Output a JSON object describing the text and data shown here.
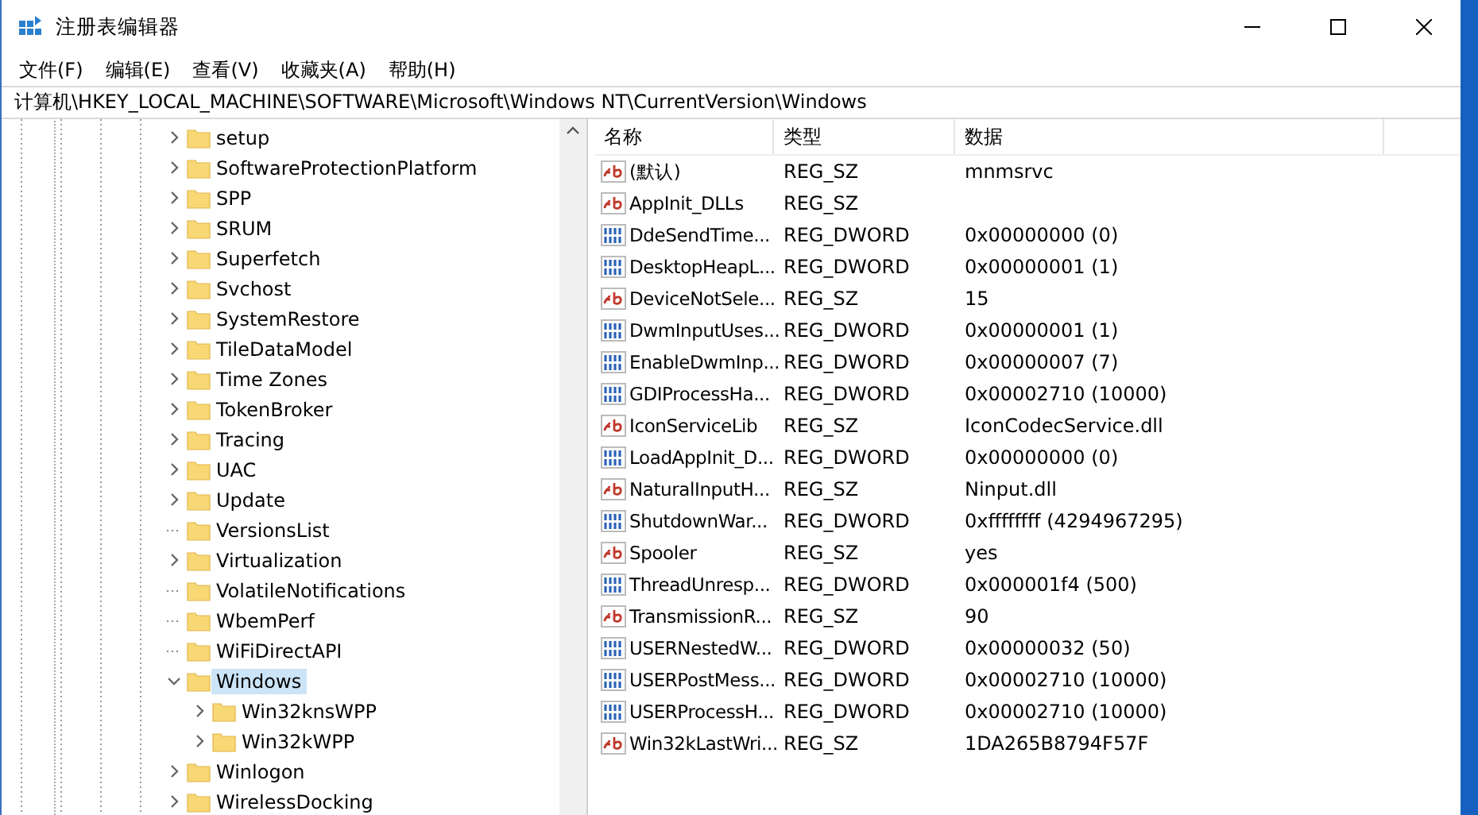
{
  "window": {
    "title": "注册表编辑器"
  },
  "menu": [
    {
      "label": "文件(F)"
    },
    {
      "label": "编辑(E)"
    },
    {
      "label": "查看(V)"
    },
    {
      "label": "收藏夹(A)"
    },
    {
      "label": "帮助(H)"
    }
  ],
  "address": "计算机\\HKEY_LOCAL_MACHINE\\SOFTWARE\\Microsoft\\Windows NT\\CurrentVersion\\Windows",
  "tree": [
    {
      "label": "setup",
      "expandable": true,
      "expanded": false,
      "selected": false
    },
    {
      "label": "SoftwareProtectionPlatform",
      "expandable": true,
      "expanded": false,
      "selected": false
    },
    {
      "label": "SPP",
      "expandable": true,
      "expanded": false,
      "selected": false
    },
    {
      "label": "SRUM",
      "expandable": true,
      "expanded": false,
      "selected": false
    },
    {
      "label": "Superfetch",
      "expandable": true,
      "expanded": false,
      "selected": false
    },
    {
      "label": "Svchost",
      "expandable": true,
      "expanded": false,
      "selected": false
    },
    {
      "label": "SystemRestore",
      "expandable": true,
      "expanded": false,
      "selected": false
    },
    {
      "label": "TileDataModel",
      "expandable": true,
      "expanded": false,
      "selected": false
    },
    {
      "label": "Time Zones",
      "expandable": true,
      "expanded": false,
      "selected": false
    },
    {
      "label": "TokenBroker",
      "expandable": true,
      "expanded": false,
      "selected": false
    },
    {
      "label": "Tracing",
      "expandable": true,
      "expanded": false,
      "selected": false
    },
    {
      "label": "UAC",
      "expandable": true,
      "expanded": false,
      "selected": false
    },
    {
      "label": "Update",
      "expandable": true,
      "expanded": false,
      "selected": false
    },
    {
      "label": "VersionsList",
      "expandable": false,
      "selected": false
    },
    {
      "label": "Virtualization",
      "expandable": true,
      "expanded": false,
      "selected": false
    },
    {
      "label": "VolatileNotifications",
      "expandable": false,
      "selected": false
    },
    {
      "label": "WbemPerf",
      "expandable": false,
      "selected": false
    },
    {
      "label": "WiFiDirectAPI",
      "expandable": false,
      "selected": false
    },
    {
      "label": "Windows",
      "expandable": true,
      "expanded": true,
      "selected": true,
      "children": [
        {
          "label": "Win32knsWPP",
          "expandable": true,
          "expanded": false,
          "selected": false
        },
        {
          "label": "Win32kWPP",
          "expandable": true,
          "expanded": false,
          "selected": false
        }
      ]
    },
    {
      "label": "Winlogon",
      "expandable": true,
      "expanded": false,
      "selected": false
    },
    {
      "label": "WirelessDocking",
      "expandable": true,
      "expanded": false,
      "selected": false
    }
  ],
  "table": {
    "columns": [
      "名称",
      "类型",
      "数据"
    ],
    "rows": [
      {
        "kind": "string",
        "name": "(默认)",
        "type": "REG_SZ",
        "data": "mnmsrvc"
      },
      {
        "kind": "string",
        "name": "AppInit_DLLs",
        "type": "REG_SZ"
      },
      {
        "kind": "binary",
        "name": "DdeSendTime...",
        "type": "REG_DWORD",
        "data": "0x00000000 (0)"
      },
      {
        "kind": "binary",
        "name": "DesktopHeapL...",
        "type": "REG_DWORD",
        "data": "0x00000001 (1)"
      },
      {
        "kind": "string",
        "name": "DeviceNotSele...",
        "type": "REG_SZ",
        "data": "15"
      },
      {
        "kind": "binary",
        "name": "DwmInputUses...",
        "type": "REG_DWORD",
        "data": "0x00000001 (1)"
      },
      {
        "kind": "binary",
        "name": "EnableDwmInp...",
        "type": "REG_DWORD",
        "data": "0x00000007 (7)"
      },
      {
        "kind": "binary",
        "name": "GDIProcessHa...",
        "type": "REG_DWORD",
        "data": "0x00002710 (10000)"
      },
      {
        "kind": "string",
        "name": "IconServiceLib",
        "type": "REG_SZ",
        "data": "IconCodecService.dll"
      },
      {
        "kind": "binary",
        "name": "LoadAppInit_D...",
        "type": "REG_DWORD",
        "data": "0x00000000 (0)"
      },
      {
        "kind": "string",
        "name": "NaturalInputH...",
        "type": "REG_SZ",
        "data": "Ninput.dll"
      },
      {
        "kind": "binary",
        "name": "ShutdownWar...",
        "type": "REG_DWORD",
        "data": "0xffffffff (4294967295)"
      },
      {
        "kind": "string",
        "name": "Spooler",
        "type": "REG_SZ",
        "data": "yes"
      },
      {
        "kind": "binary",
        "name": "ThreadUnresp...",
        "type": "REG_DWORD",
        "data": "0x000001f4 (500)"
      },
      {
        "kind": "string",
        "name": "TransmissionR...",
        "type": "REG_SZ",
        "data": "90"
      },
      {
        "kind": "binary",
        "name": "USERNestedW...",
        "type": "REG_DWORD",
        "data": "0x00000032 (50)"
      },
      {
        "kind": "binary",
        "name": "USERPostMess...",
        "type": "REG_DWORD",
        "data": "0x00002710 (10000)"
      },
      {
        "kind": "binary",
        "name": "USERProcessH...",
        "type": "REG_DWORD",
        "data": "0x00002710 (10000)"
      },
      {
        "kind": "string",
        "name": "Win32kLastWri...",
        "type": "REG_SZ",
        "data": "1DA265B8794F57F"
      }
    ]
  }
}
